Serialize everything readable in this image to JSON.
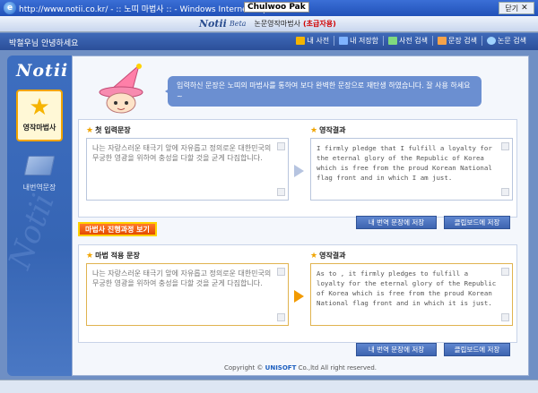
{
  "window": {
    "title": "http://www.notii.co.kr/ - :: 노띠 마법사 :: - Windows Internet Explorer",
    "username": "Chulwoo Pak",
    "close_label": "닫기",
    "close_glyph": "✕"
  },
  "brand": {
    "logo": "Notii",
    "beta": "Beta",
    "title": "논문영작마법사",
    "subtitle": "(초급자용)"
  },
  "nav": {
    "greeting": "박철우님 안녕하세요",
    "items": [
      {
        "label": "내 사전",
        "icon": "book-icon",
        "color": "#f4b400"
      },
      {
        "label": "내 저장함",
        "icon": "disk-icon",
        "color": "#7fb3ff"
      },
      {
        "label": "사전 검색",
        "icon": "dictionary-icon",
        "color": "#7fd97f"
      },
      {
        "label": "문장 검색",
        "icon": "document-icon",
        "color": "#f6a34a"
      },
      {
        "label": "논문 검색",
        "icon": "globe-icon",
        "color": "#9fd3ff"
      }
    ]
  },
  "sidebar": {
    "logo": "Notii",
    "wizard_label": "영작마법사",
    "saved_label": "내번역문장",
    "watermark": "Notii"
  },
  "bubble_text": "입력하신 문장은 노띠의 마법사를 통하여 보다 완벽한 문장으로 재탄생 하였습니다. 잘 사용 하세요~",
  "first_section": {
    "input_label": "첫 입력문장",
    "input_text": "나는 자랑스러운 태극기 앞에 자유롭고 정의로운 대한민국의 무궁한 영광을 위하여 충성을 다할 것을 굳게 다짐합니다.",
    "result_label": "영작결과",
    "result_text": "I firmly pledge that I fulfill a loyalty for the eternal glory of the Republic of Korea which is free from the proud Korean National flag front and in which I am just.",
    "save_button": "내 번역 문장에 저장",
    "clipboard_button": "클립보드에 저장"
  },
  "process_button": "마법사 진행과정 보기",
  "second_section": {
    "input_label": "마법 적용 문장",
    "input_text": "나는 자랑스러운 태극기 앞에 자유롭고 정의로운 대한민국의 무궁한 영광을 위하여 충성을 다할 것을 굳게 다짐합니다.",
    "result_label": "영작결과",
    "result_text": "As to , it firmly pledges to fulfill a loyalty for the eternal glory of the Republic of Korea which is free from the proud Korean National flag front and in which it is just.",
    "save_button": "내 번역 문장에 저장",
    "clipboard_button": "클립보드에 저장"
  },
  "footer": {
    "prefix": "Copyright ©",
    "brand": "UNISOFT",
    "suffix": "Co.,ltd All right reserved."
  }
}
